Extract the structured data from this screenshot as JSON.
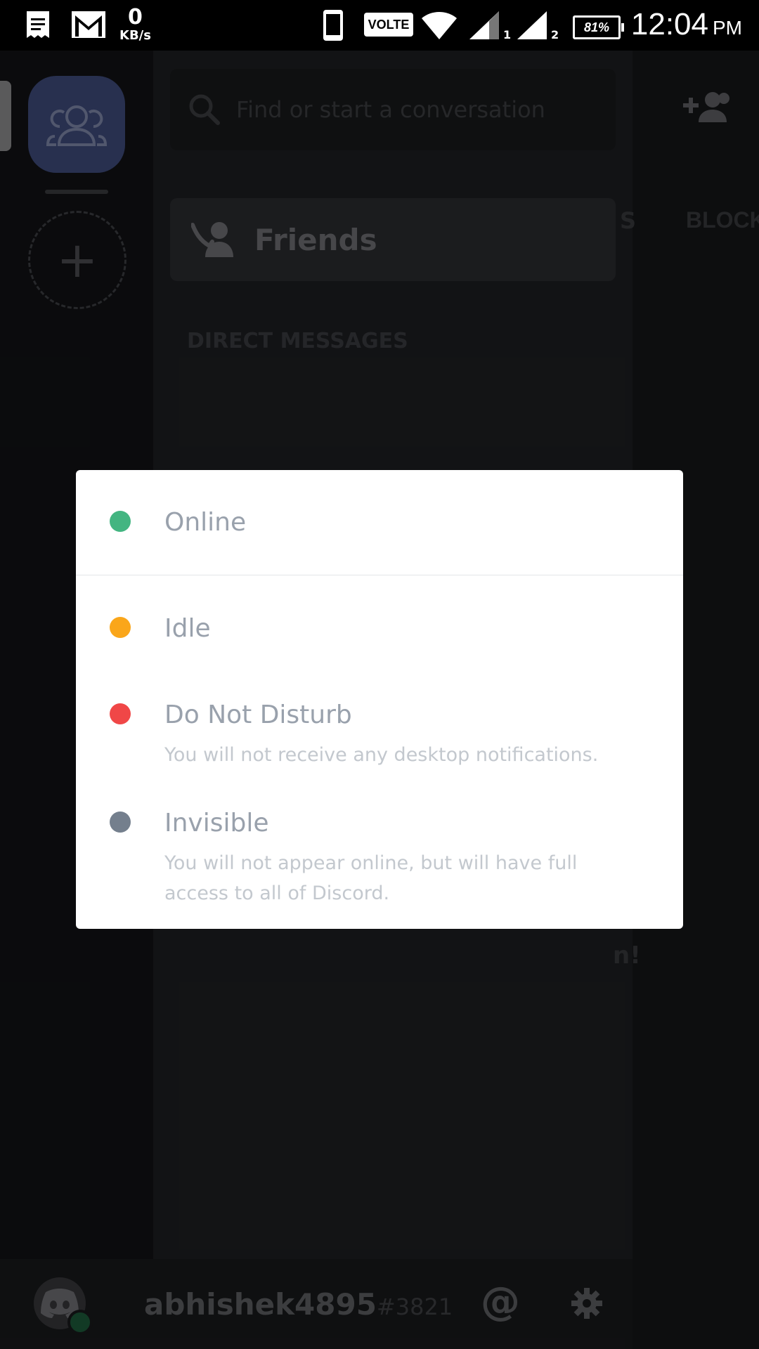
{
  "status_bar": {
    "speed_value": "0",
    "speed_unit": "KB/s",
    "volte": "VOLTE",
    "sim1": "1",
    "sim2": "2",
    "battery": "81%",
    "time": "12:04",
    "ampm": "PM"
  },
  "channels": {
    "search_placeholder": "Find or start a conversation",
    "friends_label": "Friends",
    "dm_header": "DIRECT MESSAGES"
  },
  "right_pane": {
    "tab_partial": "S",
    "tab_block": "BLOCK",
    "partial_text": "n!"
  },
  "bottom_bar": {
    "username": "abhishek4895",
    "tag": "#3821",
    "mention_symbol": "@"
  },
  "status_menu": {
    "colors": {
      "online": "#43b581",
      "idle": "#faa61a",
      "dnd": "#f04747",
      "invisible": "#747f8d"
    },
    "options": [
      {
        "title": "Online",
        "description": ""
      },
      {
        "title": "Idle",
        "description": ""
      },
      {
        "title": "Do Not Disturb",
        "description": "You will not receive any desktop notifications."
      },
      {
        "title": "Invisible",
        "description": "You will not appear online, but will have full access to all of Discord."
      }
    ]
  }
}
